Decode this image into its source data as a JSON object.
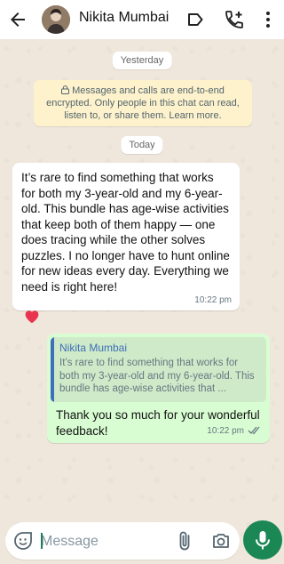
{
  "header": {
    "contact_name": "Nikita Mumbai"
  },
  "pills": {
    "yesterday": "Yesterday",
    "today": "Today"
  },
  "notice": {
    "text": "Messages and calls are end-to-end encrypted. Only people in this chat can read, listen to, or share them. Learn more."
  },
  "incoming": {
    "text": "It’s rare to find something that works for both my 3-year-old and my 6-year-old. This bundle has age-wise activities that keep both of them happy — one does tracing while the other solves puzzles. I no longer have to hunt online for new ideas every day. Everything we need is right here!",
    "time": "10:22 pm",
    "reaction": "heart"
  },
  "outgoing": {
    "quote_name": "Nikita Mumbai",
    "quote_text": "It’s rare to find something that works for both my 3-year-old and my 6-year-old. This bundle has age-wise activities that ...",
    "text": "Thank you so much for your wonderful feedback!",
    "time": "10:22 pm",
    "status": "read"
  },
  "composer": {
    "placeholder": "Message"
  },
  "colors": {
    "accent_green": "#1b8755",
    "outgoing_bubble": "#d9fdd3",
    "quote_name": "#3e6fb7",
    "notice_bg": "#fdf2cb",
    "read_ticks": "#667781"
  }
}
